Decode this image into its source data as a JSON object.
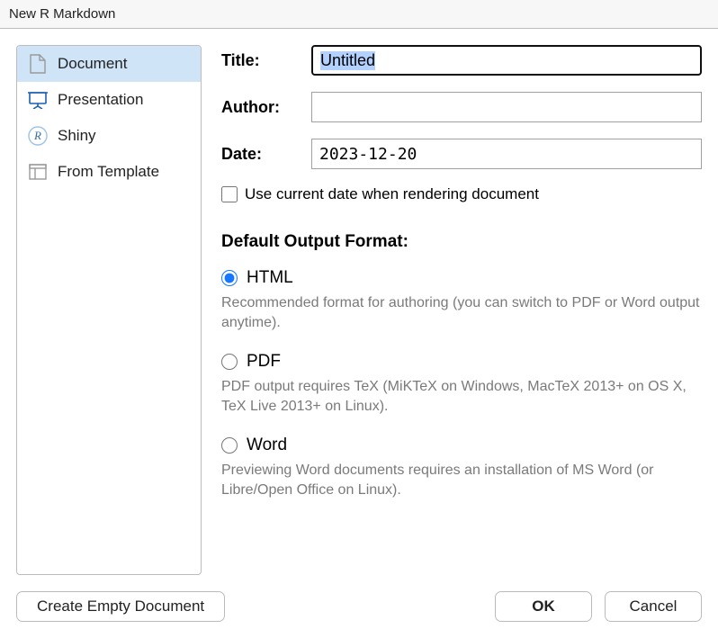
{
  "window": {
    "title": "New R Markdown"
  },
  "sidebar": {
    "items": [
      {
        "id": "document",
        "label": "Document",
        "icon": "file-icon",
        "selected": true
      },
      {
        "id": "presentation",
        "label": "Presentation",
        "icon": "presentation-icon",
        "selected": false
      },
      {
        "id": "shiny",
        "label": "Shiny",
        "icon": "r-shiny-icon",
        "selected": false
      },
      {
        "id": "from-template",
        "label": "From Template",
        "icon": "template-icon",
        "selected": false
      }
    ]
  },
  "form": {
    "title_label": "Title:",
    "title_value": "Untitled",
    "author_label": "Author:",
    "author_value": "",
    "date_label": "Date:",
    "date_value": "2023-12-20",
    "use_current_date_label": "Use current date when rendering document",
    "use_current_date_checked": false,
    "output_heading": "Default Output Format:",
    "radios": [
      {
        "id": "html",
        "label": "HTML",
        "checked": true,
        "desc": "Recommended format for authoring (you can switch to PDF or Word output anytime)."
      },
      {
        "id": "pdf",
        "label": "PDF",
        "checked": false,
        "desc": "PDF output requires TeX (MiKTeX on Windows, MacTeX 2013+ on OS X, TeX Live 2013+ on Linux)."
      },
      {
        "id": "word",
        "label": "Word",
        "checked": false,
        "desc": "Previewing Word documents requires an installation of MS Word (or Libre/Open Office on Linux)."
      }
    ]
  },
  "buttons": {
    "create_empty": "Create Empty Document",
    "ok": "OK",
    "cancel": "Cancel"
  }
}
